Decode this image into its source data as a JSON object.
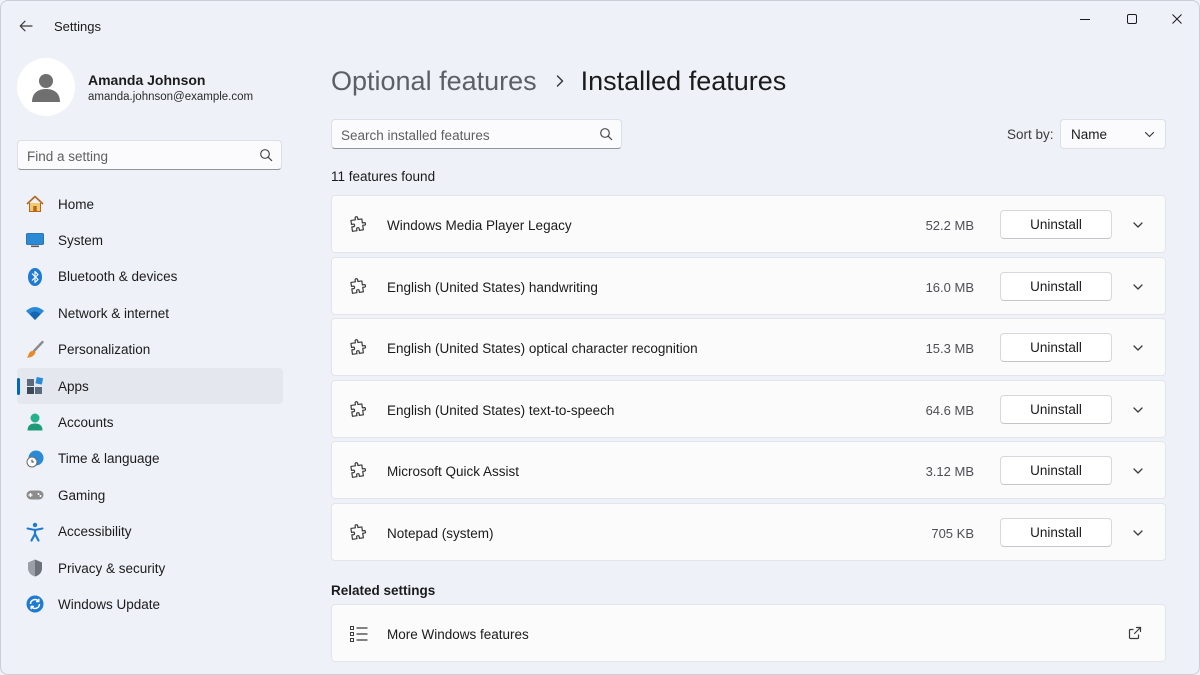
{
  "window": {
    "title": "Settings"
  },
  "profile": {
    "name": "Amanda Johnson",
    "email": "amanda.johnson@example.com"
  },
  "search_settings": {
    "placeholder": "Find a setting"
  },
  "sidebar": {
    "items": [
      {
        "label": "Home",
        "icon": "home-icon",
        "active": false
      },
      {
        "label": "System",
        "icon": "system-icon",
        "active": false
      },
      {
        "label": "Bluetooth & devices",
        "icon": "bluetooth-icon",
        "active": false
      },
      {
        "label": "Network & internet",
        "icon": "wifi-icon",
        "active": false
      },
      {
        "label": "Personalization",
        "icon": "brush-icon",
        "active": false
      },
      {
        "label": "Apps",
        "icon": "apps-icon",
        "active": true
      },
      {
        "label": "Accounts",
        "icon": "accounts-icon",
        "active": false
      },
      {
        "label": "Time & language",
        "icon": "clock-globe-icon",
        "active": false
      },
      {
        "label": "Gaming",
        "icon": "gamepad-icon",
        "active": false
      },
      {
        "label": "Accessibility",
        "icon": "accessibility-icon",
        "active": false
      },
      {
        "label": "Privacy & security",
        "icon": "shield-icon",
        "active": false
      },
      {
        "label": "Windows Update",
        "icon": "update-icon",
        "active": false
      }
    ]
  },
  "breadcrumb": {
    "parent": "Optional features",
    "current": "Installed features"
  },
  "search_features": {
    "placeholder": "Search installed features"
  },
  "sort": {
    "label": "Sort by:",
    "value": "Name"
  },
  "count_text": "11 features found",
  "features": [
    {
      "name": "Windows Media Player Legacy",
      "size": "52.2 MB",
      "action": "Uninstall"
    },
    {
      "name": "English (United States) handwriting",
      "size": "16.0 MB",
      "action": "Uninstall"
    },
    {
      "name": "English (United States) optical character recognition",
      "size": "15.3 MB",
      "action": "Uninstall"
    },
    {
      "name": "English (United States) text-to-speech",
      "size": "64.6 MB",
      "action": "Uninstall"
    },
    {
      "name": "Microsoft Quick Assist",
      "size": "3.12 MB",
      "action": "Uninstall"
    },
    {
      "name": "Notepad (system)",
      "size": "705 KB",
      "action": "Uninstall"
    }
  ],
  "related": {
    "title": "Related settings",
    "items": [
      {
        "label": "More Windows features",
        "icon": "list-icon"
      }
    ]
  },
  "colors": {
    "accent": "#0067c0",
    "background": "#eef1f8",
    "card": "#fbfbfc"
  }
}
